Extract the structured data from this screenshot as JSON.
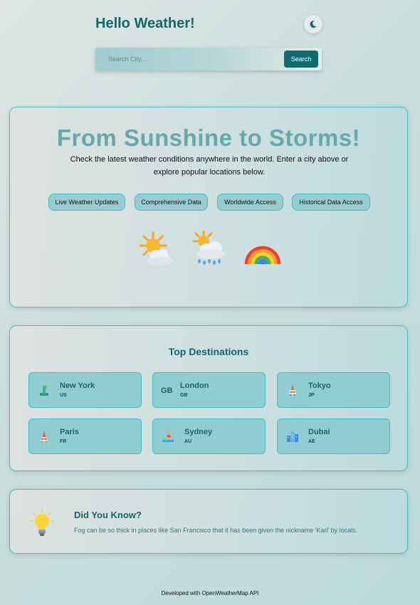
{
  "header": {
    "title": "Hello Weather!",
    "theme_icon": "moon-icon"
  },
  "search": {
    "placeholder": "Search City....",
    "value": "",
    "button_label": "Search"
  },
  "hero": {
    "title": "From Sunshine to Storms!",
    "description": "Check the latest weather conditions anywhere in the world. Enter a city above or explore popular locations below.",
    "features": [
      "Live Weather Updates",
      "Comprehensive Data",
      "Worldwide Access",
      "Historical Data Access"
    ],
    "icons": [
      "sun-behind-cloud-icon",
      "sun-behind-rain-cloud-icon",
      "rainbow-icon"
    ]
  },
  "destinations": {
    "heading": "Top Destinations",
    "items": [
      {
        "name": "New York",
        "country": "US",
        "icon": "statue-of-liberty-icon"
      },
      {
        "name": "London",
        "country": "GB",
        "icon": "gb-flag-icon",
        "icon_text": "GB"
      },
      {
        "name": "Tokyo",
        "country": "JP",
        "icon": "tokyo-tower-icon"
      },
      {
        "name": "Paris",
        "country": "FR",
        "icon": "eiffel-tower-icon"
      },
      {
        "name": "Sydney",
        "country": "AU",
        "icon": "surfer-icon"
      },
      {
        "name": "Dubai",
        "country": "AE",
        "icon": "cityscape-icon"
      }
    ]
  },
  "tip": {
    "title": "Did You Know?",
    "text": "Fog can be so thick in places like San Francisco that it has been given the nickname 'Karl' by locals.",
    "icon": "lightbulb-icon"
  },
  "footer": {
    "text": "Developed with OpenWeatherMap API"
  },
  "colors": {
    "accent": "#17656d",
    "button": "#0f6b70",
    "border": "#3fbec7",
    "pill": "#96cdd3",
    "hero_title": "#66a8ad"
  }
}
